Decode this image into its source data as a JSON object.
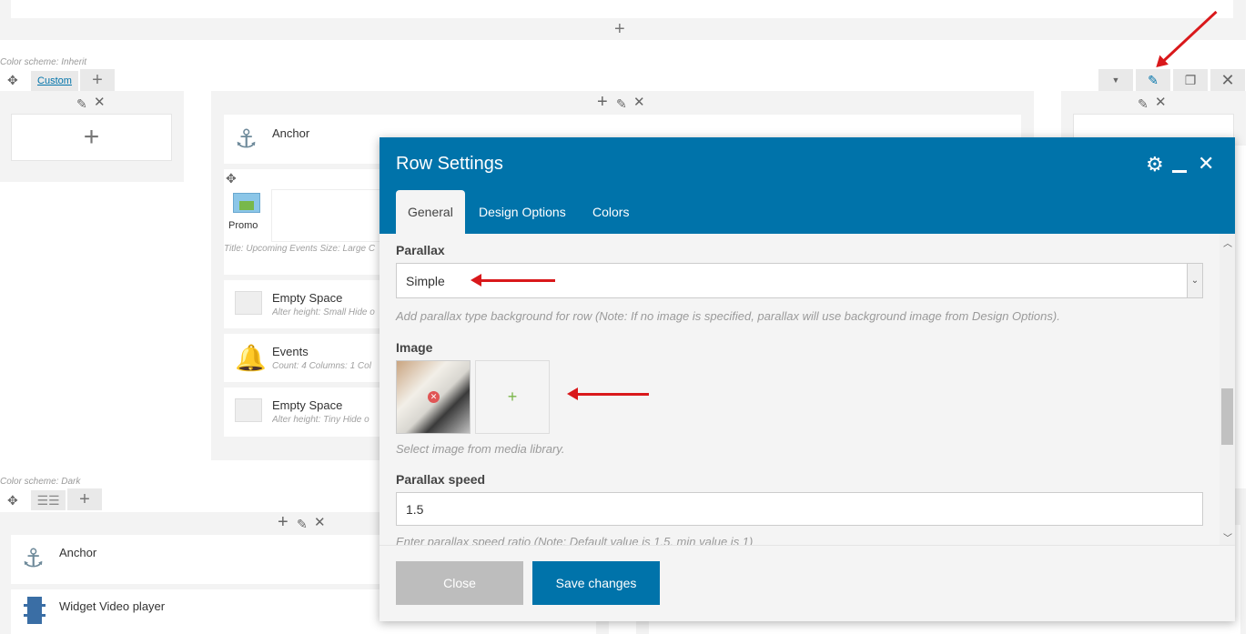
{
  "top_section": {
    "add_icon": "plus-icon"
  },
  "row1": {
    "color_scheme": "Color scheme: Inherit",
    "custom_label": "Custom",
    "controls": [
      "chevron-down-icon",
      "pencil-icon",
      "clone-icon",
      "close-icon"
    ]
  },
  "row1_center": {
    "elements": [
      {
        "title": "Anchor",
        "icon": "anchor-icon",
        "sub": ""
      },
      {
        "title": "Empty Space",
        "icon": "empty-space-icon",
        "sub": "Alter height: Small  Hide o"
      },
      {
        "title": "Events",
        "icon": "bell-icon",
        "sub": "Count: 4  Columns: 1  Col"
      },
      {
        "title": "Empty Space",
        "icon": "empty-space-icon",
        "sub": "Alter height: Tiny  Hide o"
      }
    ],
    "promo_label": "Promo",
    "promo_sub": "Title: Upcoming Events  Size: Large  C"
  },
  "row2": {
    "color_scheme": "Color scheme: Dark",
    "elements": [
      {
        "title": "Anchor",
        "icon": "anchor-icon"
      },
      {
        "title": "Widget Video player",
        "icon": "film-icon"
      }
    ]
  },
  "modal": {
    "title": "Row Settings",
    "tabs": [
      "General",
      "Design Options",
      "Colors"
    ],
    "parallax_label": "Parallax",
    "parallax_value": "Simple",
    "parallax_help": "Add parallax type background for row (Note: If no image is specified, parallax will use background image from Design Options).",
    "image_label": "Image",
    "image_add": "+",
    "image_help": "Select image from media library.",
    "speed_label": "Parallax speed",
    "speed_value": "1.5",
    "speed_help": "Enter parallax speed ratio (Note: Default value is 1.5, min value is 1)",
    "close_label": "Close",
    "save_label": "Save changes"
  },
  "colors": {
    "accent": "#0073aa",
    "arrow": "#d9181b",
    "panel": "#f3f3f3"
  }
}
